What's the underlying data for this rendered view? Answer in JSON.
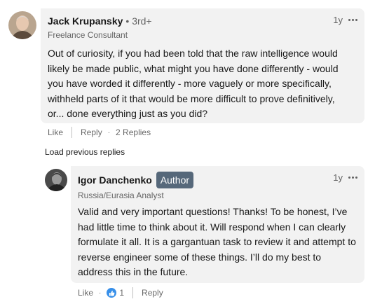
{
  "comment": {
    "author": "Jack Krupansky",
    "degree": "• 3rd+",
    "headline": "Freelance Consultant",
    "time": "1y",
    "text": "Out of curiosity, if you had been told that the raw intelligence would likely be made public, what might you have done differently - would you have worded it differently - more vaguely or more specifically, withheld parts of it that would be more difficult to prove definitively, or... done everything just as you did?",
    "actions": {
      "like": "Like",
      "reply": "Reply",
      "replies": "2 Replies",
      "dot": "·"
    }
  },
  "load_previous": "Load previous replies",
  "reply": {
    "author": "Igor Danchenko",
    "badge": "Author",
    "headline": "Russia/Eurasia Analyst",
    "time": "1y",
    "text": "Valid and very important questions! Thanks! To be honest, I’ve had little time to think about it. Will respond when I can clearly formulate it all. It is a gargantuan task to review it and attempt to reverse engineer some of these things. I’ll do my best to address this in the future.",
    "actions": {
      "like": "Like",
      "dot": "·",
      "reaction_count": "1",
      "reply": "Reply"
    }
  },
  "icons": {
    "menu": "more-options-icon",
    "reaction": "thumbs-up-icon"
  },
  "colors": {
    "bubble": "#f2f2f2",
    "badge": "#56687a",
    "like_blue": "#378fe9"
  }
}
